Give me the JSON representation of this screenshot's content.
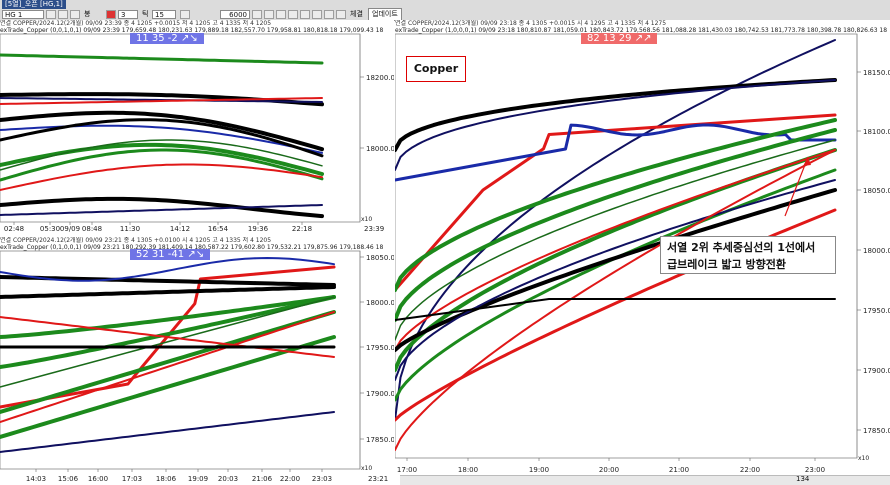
{
  "toolbar": {
    "title": "[5열]_오픈 [HG,1]",
    "symbol": "HG 1",
    "period_value": "3",
    "period_unit": "틱",
    "count": "15",
    "bar_count": "6000",
    "mode_label": "봉",
    "trade_label": "체결",
    "update_label": "업데이트"
  },
  "panels": {
    "topleft": {
      "header": "연결 COPPER/2024.12(2개월) 09/09 23:39  종 4 1205 +0.0015  저 4 1205 고 4 1335 저 4 1205",
      "indicator": "exTrade_Copper (0,0,1,0,1) 09/09 23:39 179,659.48 180,231.63 179,889.18 182,557.70 179,958.81 180,818.18 179,099.43 18",
      "badge": "11 35 -2 ↗↘",
      "yticks": [
        "18200.00",
        "18000.00"
      ],
      "xticks": [
        "02:48",
        "05:30",
        "09/09",
        "08:48",
        "11:30",
        "14:12",
        "16:54",
        "19:36",
        "22:18",
        "23:39"
      ],
      "scale": "x10"
    },
    "bottomleft": {
      "header": "연결 COPPER/2024.12(2개월) 09/09 23:21  종 4 1305 +0.0100  시 4 1205 고 4 1335 저 4 1205",
      "indicator": "exTrade_Copper (0,1,0,0,1) 09/09 23:21 180,292.39 181,409.14 180,587.22 179,602.80 179,532.21 179,875.96 179,188.46 18",
      "badge": "52 31 -41 ↗↘",
      "yticks": [
        "18050.00",
        "18000.00",
        "17950.00",
        "17900.00",
        "17850.00"
      ],
      "xticks": [
        "14:03",
        "15:06",
        "16:00",
        "17:03",
        "18:06",
        "19:09",
        "20:03",
        "21:06",
        "22:00",
        "23:03",
        "23:21"
      ],
      "scale": "x10"
    },
    "right": {
      "header": "연결 COPPER/2024.12(3개월) 09/09 23:18  종 4 1305 +0.0015  시 4 1295 고 4 1335 저 4 1275",
      "indicator": "exTrade_Copper (1,0,0,0,1) 09/09 23:18 180,810.87 181,059.01 180,843.72 179,568.56 181,088.28 181,430.03 180,742.53 181,773.78 180,398.78 180,826.63 18",
      "badge": "82 13 29 ↗↗",
      "yticks": [
        "18150.00",
        "18100.00",
        "18050.00",
        "18000.00",
        "17950.00",
        "17900.00",
        "17850.00"
      ],
      "xticks": [
        "17:00",
        "18:00",
        "19:00",
        "20:00",
        "21:00",
        "22:00",
        "23:00"
      ],
      "scale": "x10",
      "zoom": "134",
      "copper_label": "Copper",
      "note_line1": "서열 2위 추세중심선의 1선에서",
      "note_line2": "급브레이크 밟고 방향전환"
    }
  },
  "colors": {
    "red": "#e01818",
    "green": "#1c8a1c",
    "black": "#000000",
    "blue": "#1a2aa8",
    "navy": "#101060",
    "darkgreen": "#1a6a1a",
    "arrow": "#e01818"
  }
}
